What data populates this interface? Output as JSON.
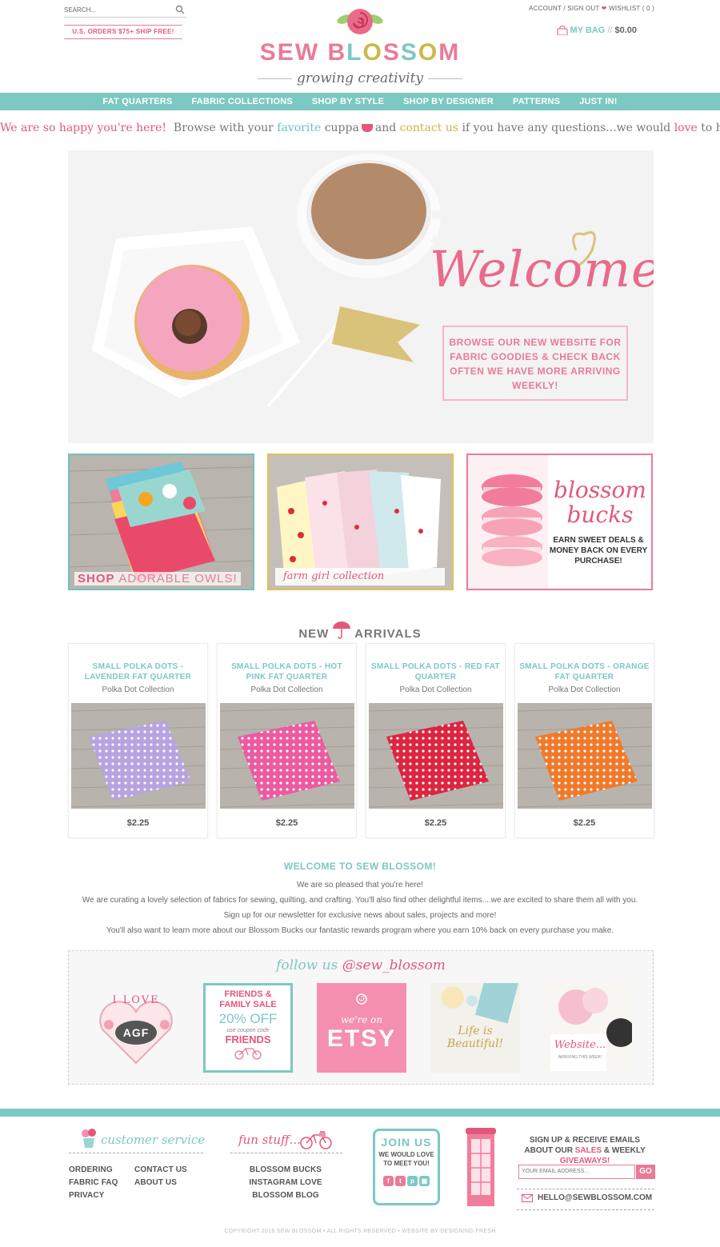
{
  "header": {
    "search_label": "SEARCH...",
    "ship_banner": "U.S. ORDERS $75+ SHIP FREE!",
    "account_label": "ACCOUNT / SIGN OUT",
    "wishlist_label": "WISHLIST ( 0 )",
    "bag_label": "MY BAG",
    "bag_sep": "//",
    "bag_amount": "$0.00",
    "logo_sew": "SEW",
    "logo_blossom_letters": [
      "B",
      "L",
      "O",
      "S",
      "S",
      "O",
      "M"
    ],
    "tagline": "growing creativity"
  },
  "nav": {
    "items": [
      "FAT QUARTERS",
      "FABRIC COLLECTIONS",
      "SHOP BY STYLE",
      "SHOP BY DESIGNER",
      "PATTERNS",
      "JUST IN!"
    ]
  },
  "intro": {
    "part1": "We are so happy you're here!",
    "part2": "Browse with your",
    "part3": "favorite",
    "part4": "cuppa",
    "part5": "and",
    "part6": "contact us",
    "part7": "if you have any questions...we would",
    "part8": "love",
    "part9": "to help!"
  },
  "hero": {
    "welcome": "Welcome!",
    "browse_text": "BROWSE OUR NEW WEBSITE FOR FABRIC GOODIES & CHECK BACK OFTEN WE HAVE MORE ARRIVING WEEKLY!"
  },
  "tiles": {
    "owls_shop": "SHOP",
    "owls_rest": "ADORABLE OWLS!",
    "farm_caption": "farm girl collection »»»»»»»»»»»",
    "bucks_title_1": "blossom",
    "bucks_title_2": "bucks",
    "bucks_text": "EARN SWEET DEALS & MONEY BACK ON EVERY PURCHASE!"
  },
  "arrivals": {
    "title_new": "NEW",
    "title_rest": "ARRIVALS",
    "products": [
      {
        "name": "SMALL POLKA DOTS - LAVENDER FAT QUARTER",
        "collection": "Polka Dot Collection",
        "price": "$2.25",
        "color": "#b7a3e0"
      },
      {
        "name": "SMALL POLKA DOTS - HOT PINK FAT QUARTER",
        "collection": "Polka Dot Collection",
        "price": "$2.25",
        "color": "#ec5aa0"
      },
      {
        "name": "SMALL POLKA DOTS - RED FAT QUARTER",
        "collection": "Polka Dot Collection",
        "price": "$2.25",
        "color": "#dc2540"
      },
      {
        "name": "SMALL POLKA DOTS - ORANGE FAT QUARTER",
        "collection": "Polka Dot Collection",
        "price": "$2.25",
        "color": "#f07a2c"
      }
    ]
  },
  "welcome_section": {
    "title": "WELCOME TO SEW BLOSSOM!",
    "lines": [
      "We are so pleased that you're here!",
      "We are curating a lovely selection of fabrics for sewing, quilting, and crafting. You'll also find other delightful items....we are excited to share them all with you.",
      "Sign up for our newsletter for exclusive news about sales, projects and more!",
      "You'll also want to learn more about our Blossom Bucks our fantastic rewards program where you earn 10% back on every purchase you make."
    ]
  },
  "follow": {
    "title_1": "follow us",
    "title_2": "@sew_blossom",
    "ig1_text": "I LOVE",
    "ig1_badge": "AGF",
    "ig2_l1": "FRIENDS &",
    "ig2_l2": "FAMILY SALE",
    "ig2_l3": "20% OFF",
    "ig2_l4": "use coupon code",
    "ig2_l5": "FRIENDS",
    "ig3_l1": "we're on",
    "ig3_l2": "ETSY",
    "ig4_text": "Life is Beautiful!",
    "ig5_text": "Website...",
    "ig5_sub": "ARRIVING THIS WEEK!"
  },
  "footer": {
    "customer_service_title": "customer service",
    "cs_col1": [
      "ORDERING",
      "FABRIC FAQ",
      "PRIVACY"
    ],
    "cs_col2": [
      "CONTACT US",
      "ABOUT US"
    ],
    "fun_title": "fun stuff...",
    "fun_links": [
      "BLOSSOM BUCKS",
      "INSTAGRAM LOVE",
      "BLOSSOM BLOG"
    ],
    "join_title": "JOIN US",
    "join_text": "WE WOULD LOVE TO MEET YOU!",
    "signup_1": "SIGN UP & RECEIVE EMAILS ABOUT OUR",
    "signup_sales": "SALES",
    "signup_2": "& WEEKLY",
    "signup_giveaways": "GIVEAWAYS!",
    "email_placeholder": "YOUR EMAIL ADDRESS...",
    "go_label": "GO",
    "hello_email": "HELLO@SEWBLOSSOM.COM",
    "copyright": "COPYRIGHT 2016 SEW BLOSSOM • ALL RIGHTS RESERVED • WEBSITE BY DESIGNING FRESH"
  },
  "colors": {
    "teal": "#7cc8c3",
    "pink": "#e2587a",
    "blossom_letters": [
      "#e97b97",
      "#7cc8c3",
      "#c9b94a",
      "#e97b97",
      "#7cc8c3",
      "#c9b94a",
      "#e97b97"
    ]
  }
}
